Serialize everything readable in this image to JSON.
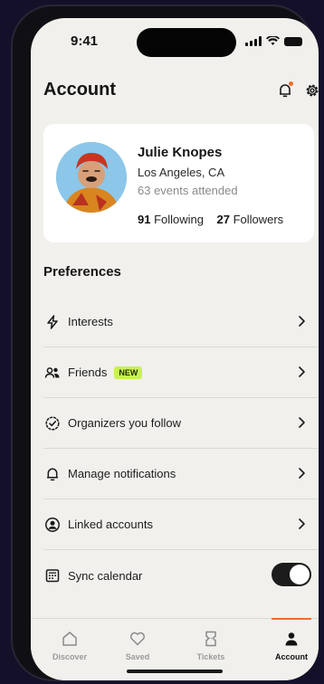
{
  "status_bar": {
    "time": "9:41"
  },
  "header": {
    "title": "Account",
    "notification_icon": "bell-icon",
    "settings_icon": "gear-icon"
  },
  "profile": {
    "name": "Julie Knopes",
    "location": "Los Angeles, CA",
    "events": "63 events attended",
    "following_count": "91",
    "following_label": "Following",
    "followers_count": "27",
    "followers_label": "Followers"
  },
  "preferences": {
    "title": "Preferences",
    "items": [
      {
        "label": "Interests",
        "icon": "lightning-icon"
      },
      {
        "label": "Friends",
        "icon": "people-icon",
        "badge": "NEW"
      },
      {
        "label": "Organizers you follow",
        "icon": "verified-badge-icon"
      },
      {
        "label": "Manage notifications",
        "icon": "bell-icon"
      },
      {
        "label": "Linked accounts",
        "icon": "user-circle-icon"
      },
      {
        "label": "Sync calendar",
        "icon": "calendar-icon",
        "toggle_on": true
      }
    ]
  },
  "tab_bar": {
    "tabs": [
      {
        "label": "Discover",
        "icon": "home-icon"
      },
      {
        "label": "Saved",
        "icon": "heart-icon"
      },
      {
        "label": "Tickets",
        "icon": "ticket-icon"
      },
      {
        "label": "Account",
        "icon": "person-icon",
        "active": true
      }
    ]
  },
  "colors": {
    "accent": "#f26a2e",
    "badge": "#c9f24f",
    "background": "#f1f0ec",
    "card": "#ffffff"
  }
}
